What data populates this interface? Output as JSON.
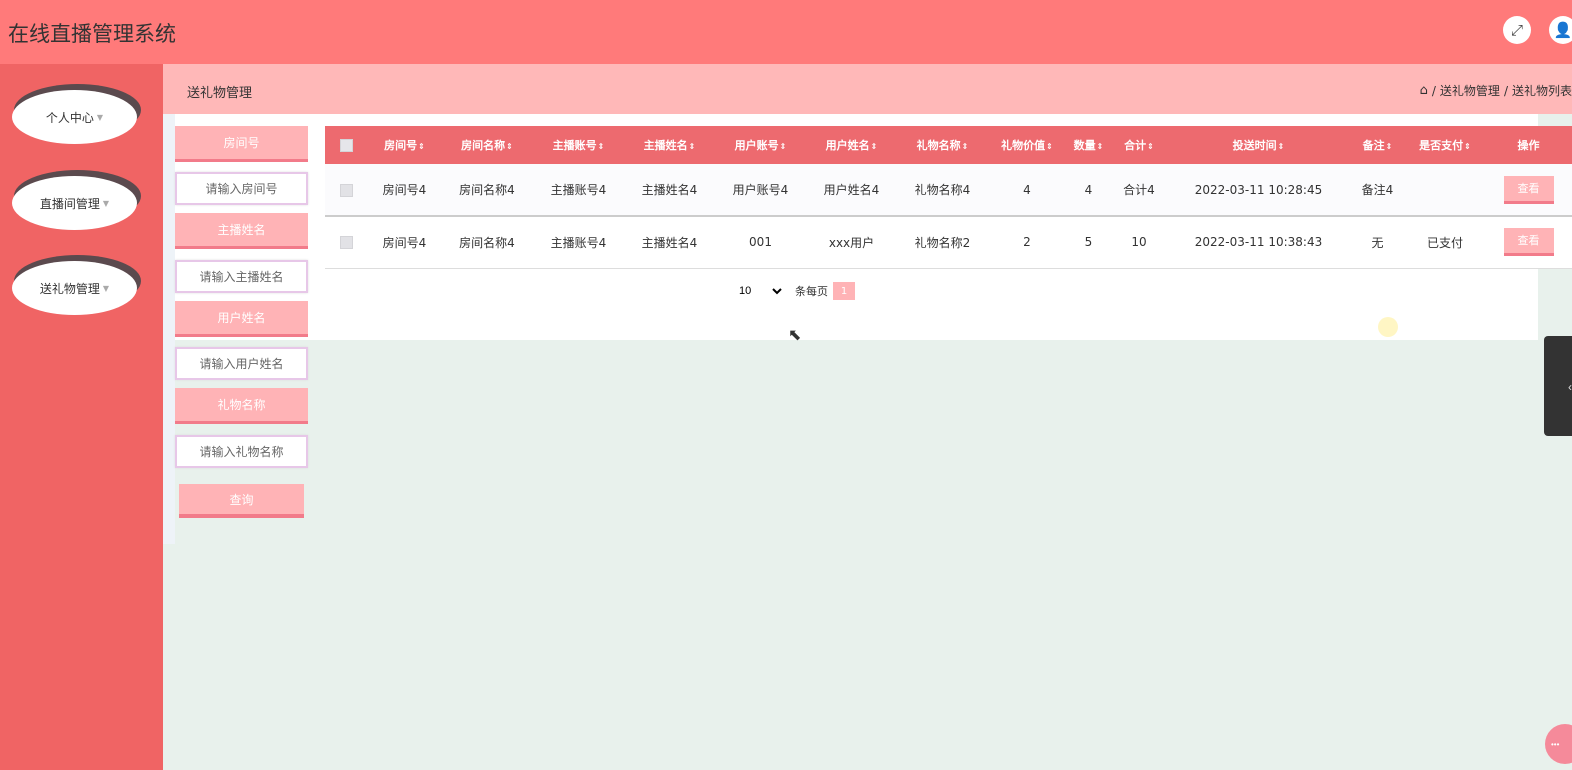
{
  "app": {
    "title": "在线直播管理系统"
  },
  "header": {
    "fullscreen_icon": "expand-icon",
    "user_icon": "user-icon"
  },
  "sidebar": {
    "items": [
      {
        "label": "个人中心"
      },
      {
        "label": "直播间管理"
      },
      {
        "label": "送礼物管理"
      }
    ]
  },
  "breadcrumb": {
    "title": "送礼物管理",
    "separator": "/",
    "items": [
      "送礼物管理",
      "送礼物列表"
    ]
  },
  "search": {
    "fields": [
      {
        "label": "房间号",
        "placeholder": "请输入房间号"
      },
      {
        "label": "主播姓名",
        "placeholder": "请输入主播姓名"
      },
      {
        "label": "用户姓名",
        "placeholder": "请输入用户姓名"
      },
      {
        "label": "礼物名称",
        "placeholder": "请输入礼物名称"
      }
    ],
    "query_label": "查询"
  },
  "table": {
    "headers": [
      "房间号",
      "房间名称",
      "主播账号",
      "主播姓名",
      "用户账号",
      "用户姓名",
      "礼物名称",
      "礼物价值",
      "数量",
      "合计",
      "投送时间",
      "备注",
      "是否支付",
      "操作"
    ],
    "sort_glyph": "⇕",
    "rows": [
      [
        "房间号4",
        "房间名称4",
        "主播账号4",
        "主播姓名4",
        "用户账号4",
        "用户姓名4",
        "礼物名称4",
        "4",
        "4",
        "合计4",
        "2022-03-11 10:28:45",
        "备注4",
        ""
      ],
      [
        "房间号4",
        "房间名称4",
        "主播账号4",
        "主播姓名4",
        "001",
        "xxx用户",
        "礼物名称2",
        "2",
        "5",
        "10",
        "2022-03-11 10:38:43",
        "无",
        "已支付"
      ]
    ],
    "action_label": "查看"
  },
  "pagination": {
    "page_size": "10",
    "page_size_options": [
      "10"
    ],
    "per_page_label": "条每页",
    "current_page": "1"
  },
  "colors": {
    "header": "#ff7a7a",
    "sidebar": "#f06464",
    "breadcrumb_bar": "#ffb8b8",
    "table_header": "#ed6a6f",
    "button": "#ffb3b6"
  }
}
